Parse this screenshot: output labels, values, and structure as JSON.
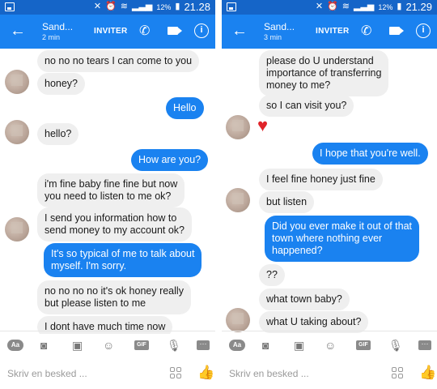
{
  "left": {
    "status": {
      "battery": "12%",
      "time": "21.28"
    },
    "header": {
      "name": "Sand...",
      "sub": "2 min",
      "invite": "INVITER"
    },
    "messages": [
      {
        "text": "no no no tears I can come to you"
      },
      {
        "text": "honey?"
      },
      {
        "text": "Hello"
      },
      {
        "text": "hello?"
      },
      {
        "text": "How are you?"
      },
      {
        "text": "i'm fine baby fine fine but now\nyou need to listen to me ok?"
      },
      {
        "text": "I send you information how to\nsend money to my account ok?"
      },
      {
        "text": "It's so typical of me to talk about\nmyself. I'm sorry."
      },
      {
        "text": "no no no no it's ok honey really\nbut please listen to me"
      },
      {
        "text": "I dont have much time now"
      }
    ],
    "composer": {
      "placeholder": "Skriv en besked ..."
    }
  },
  "right": {
    "status": {
      "battery": "12%",
      "time": "21.29"
    },
    "header": {
      "name": "Sand...",
      "sub": "3 min",
      "invite": "INVITER"
    },
    "messages": [
      {
        "text": "please do U understand\nimportance of transferring\nmoney to me?"
      },
      {
        "text": "so I can visit you?"
      },
      {
        "text": "I hope that you're well."
      },
      {
        "text": "I feel fine honey just fine"
      },
      {
        "text": "but listen"
      },
      {
        "text": "Did you ever make it out of that\ntown where nothing ever\nhappened?"
      },
      {
        "text": "??"
      },
      {
        "text": "what town baby?"
      },
      {
        "text": "what U taking about?"
      }
    ],
    "composer": {
      "placeholder": "Skriv en besked ..."
    }
  },
  "toolbar": {
    "aa": "Aa",
    "gif": "GIF"
  },
  "icons": {
    "back": "arrow-left-icon",
    "phone": "phone-icon",
    "video": "video-camera-icon",
    "info": "info-icon",
    "camera": "camera-icon",
    "image": "image-icon",
    "emoji": "emoji-icon",
    "mic": "microphone-icon",
    "more": "more-icon",
    "like": "thumbs-up-icon",
    "reaction": "heart-icon"
  },
  "colors": {
    "statusbar": "#1565c8",
    "appbar": "#1a82f0",
    "outgoing": "#1a82f0",
    "incoming": "#efefef",
    "heart": "#e0242a"
  }
}
